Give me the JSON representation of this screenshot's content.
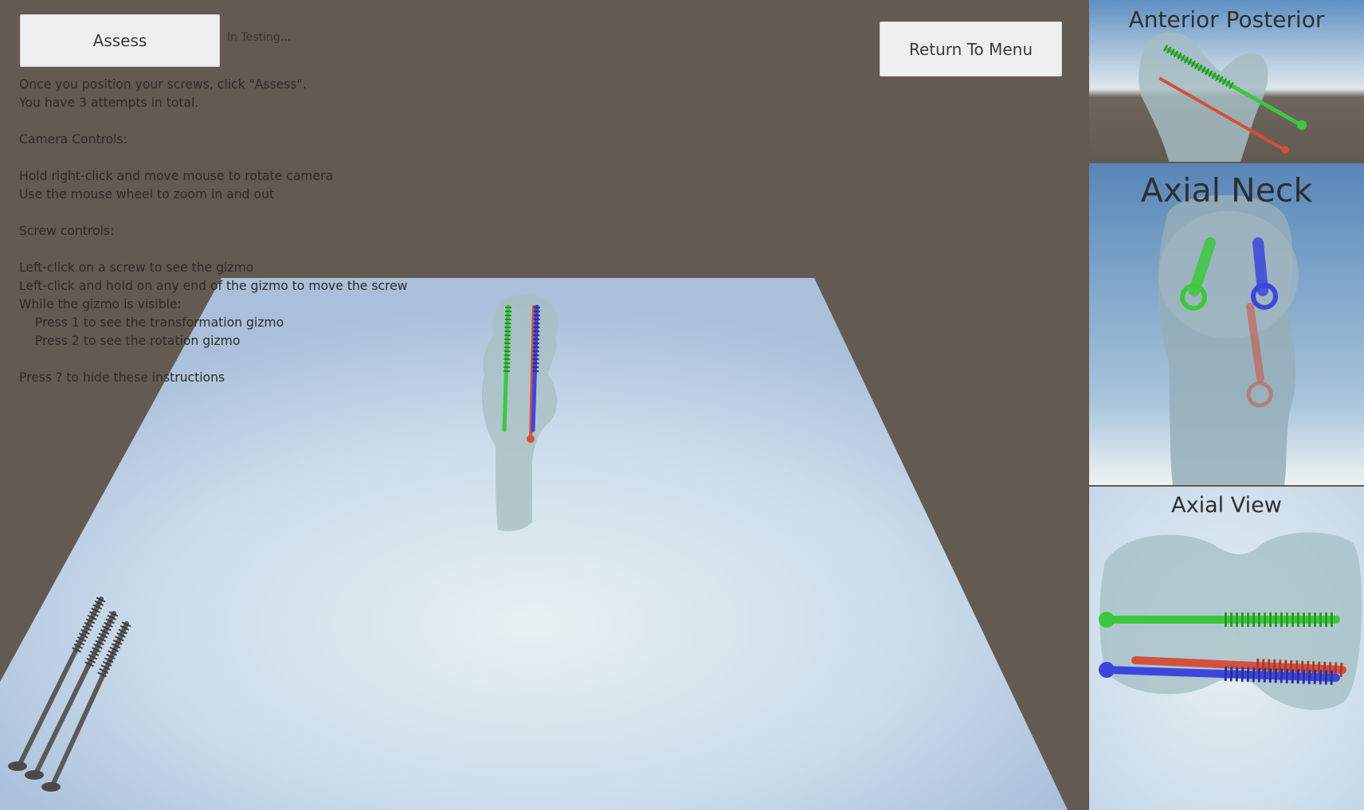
{
  "toolbar": {
    "assess_label": "Assess",
    "status_text": "In Testing...",
    "return_label": "Return To Menu"
  },
  "instructions": [
    "Once you position your screws, click \"Assess\".",
    "You have 3 attempts in total.",
    "",
    "Camera Controls:",
    "",
    "Hold right-click and move mouse to rotate camera",
    "Use the mouse wheel to zoom in and out",
    "",
    "Screw controls:",
    "",
    "Left-click on a screw to see the gizmo",
    "Left-click and hold on any end of the gizmo to move the screw",
    "While the gizmo is visible:",
    "    Press 1 to see the transformation gizmo",
    "    Press 2 to see the rotation gizmo",
    "",
    "Press ? to hide these instructions"
  ],
  "views": {
    "anterior_posterior": "Anterior Posterior",
    "axial_neck": "Axial Neck",
    "axial_view": "Axial View"
  },
  "colors": {
    "background": "#635a52",
    "button": "#efefef",
    "screw_green": "#3cc83c",
    "screw_blue": "#3c46dc",
    "screw_red": "#d2503c",
    "screw_grey": "#5a5a5a"
  }
}
